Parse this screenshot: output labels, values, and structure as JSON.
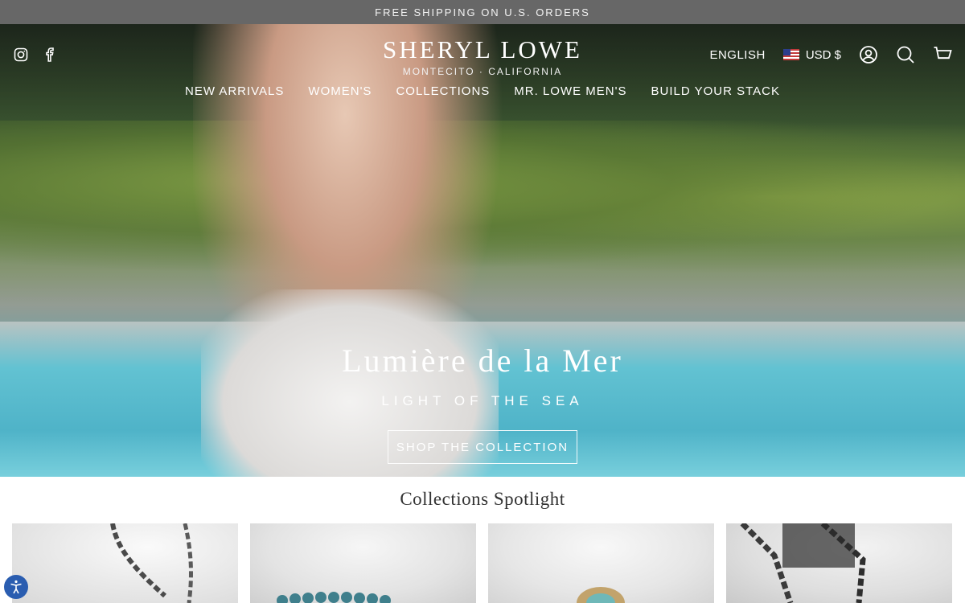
{
  "announcement": {
    "text": "FREE SHIPPING ON U.S. ORDERS"
  },
  "header": {
    "logo": {
      "name": "SHERYL LOWE",
      "tagline": "MONTECITO · CALIFORNIA"
    },
    "social": [
      {
        "icon": "instagram-icon"
      },
      {
        "icon": "facebook-icon"
      }
    ],
    "language": "ENGLISH",
    "currency": "USD $",
    "icons": [
      "account-icon",
      "search-icon",
      "cart-icon"
    ]
  },
  "nav": {
    "items": [
      {
        "label": "NEW ARRIVALS"
      },
      {
        "label": "WOMEN'S"
      },
      {
        "label": "COLLECTIONS"
      },
      {
        "label": "MR. LOWE MEN'S"
      },
      {
        "label": "BUILD YOUR STACK"
      }
    ]
  },
  "hero": {
    "title": "Lumière de la Mer",
    "subtitle": "LIGHT OF THE SEA",
    "cta": "SHOP THE COLLECTION"
  },
  "spotlight": {
    "title": "Collections Spotlight"
  },
  "colors": {
    "announcement_bg": "#676767",
    "accessibility_bg": "#2a5db0"
  }
}
